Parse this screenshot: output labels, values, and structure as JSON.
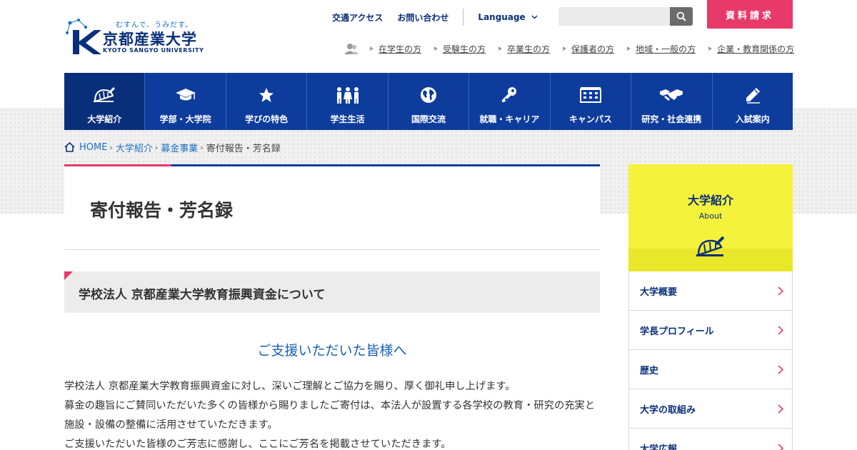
{
  "logo": {
    "tagline": "むすんで、うみだす。",
    "name": "京都産業大学",
    "name_en": "KYOTO SANGYO UNIVERSITY"
  },
  "utility": {
    "access": "交通アクセス",
    "contact": "お問い合わせ",
    "language": "Language"
  },
  "search": {
    "placeholder": ""
  },
  "request_button": "資料請求",
  "audience": [
    "在学生の方",
    "受験生の方",
    "卒業生の方",
    "保護者の方",
    "地域・一般の方",
    "企業・教育関係の方"
  ],
  "gnav": [
    {
      "label": "大学紹介",
      "icon": "dome-icon",
      "active": true
    },
    {
      "label": "学部・大学院",
      "icon": "graduation-cap-icon"
    },
    {
      "label": "学びの特色",
      "icon": "star-icon"
    },
    {
      "label": "学生生活",
      "icon": "people-icon"
    },
    {
      "label": "国際交流",
      "icon": "globe-icon"
    },
    {
      "label": "就職・キャリア",
      "icon": "key-icon"
    },
    {
      "label": "キャンパス",
      "icon": "building-icon"
    },
    {
      "label": "研究・社会連携",
      "icon": "handshake-icon"
    },
    {
      "label": "入試案内",
      "icon": "pencil-icon"
    }
  ],
  "breadcrumb": {
    "home": "HOME",
    "items": [
      "大学紹介",
      "募金事業"
    ],
    "current": "寄付報告・芳名録"
  },
  "page_title": "寄付報告・芳名録",
  "section": {
    "heading": "学校法人 京都産業大学教育振興資金について",
    "subtitle": "ご支援いただいた皆様へ",
    "paragraphs": [
      "学校法人 京都産業大学教育振興資金に対し、深いご理解とご協力を賜り、厚く御礼申し上げます。",
      "募金の趣旨にご賛同いただいた多くの皆様から賜りましたご寄付は、本法人が設置する各学校の教育・研究の充実と施設・設備の整備に活用させていただきます。",
      "ご支援いただいた皆様のご芳志に感謝し、ここにご芳名を掲載させていただきます。"
    ]
  },
  "side": {
    "title": "大学紹介",
    "title_en": "About",
    "items": [
      "大学概要",
      "学長プロフィール",
      "歴史",
      "大学の取組み",
      "大学広報"
    ]
  },
  "colors": {
    "navy": "#0d3c9c",
    "pink": "#e8396b",
    "yellow": "#f4f23a",
    "link": "#1a6fc4"
  }
}
